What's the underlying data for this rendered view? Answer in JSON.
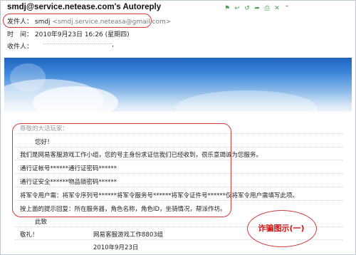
{
  "email": {
    "subject": "smdj@service.netease.com's Autoreply",
    "toolbar_icons": [
      "flag-icon",
      "reply-icon",
      "reply-all-icon",
      "forward-icon",
      "print-icon",
      "delete-icon",
      "collapse-icon"
    ],
    "from_label": "发件人：",
    "from_name": "smdj",
    "from_email": "<smdj.service.neteasa@gmail.com>",
    "time_label": "时　间：",
    "time_value": "2010年9月23日 16:26 (星期四)",
    "to_label": "收件人：",
    "to_value": ","
  },
  "message": {
    "greeting_prefix": "尊敬的大话玩家：",
    "hello": "您好！",
    "lines": [
      "我们是网易客服游戏工作小组，您的号主身份求证信我们已经收到，很乐意竭诚为您服务。",
      "通行证帐号******通行证密码******",
      "通行证安全******物品锁密码******",
      "将军令用户需：将军令序列号******将军令服务号******将军令证件号******仅将军令用户需填写此项。",
      "按上面的提示回复：所在服务器，角色名称，角色ID，坐骑情况，帮派作坊。"
    ],
    "closing": "此致",
    "salute": "敬礼！",
    "signature": "网易客服游戏工作8803组",
    "date": "2010年9月23日"
  },
  "annotation": {
    "label": "诈骗图示(一)",
    "color": "#d23a3a"
  }
}
